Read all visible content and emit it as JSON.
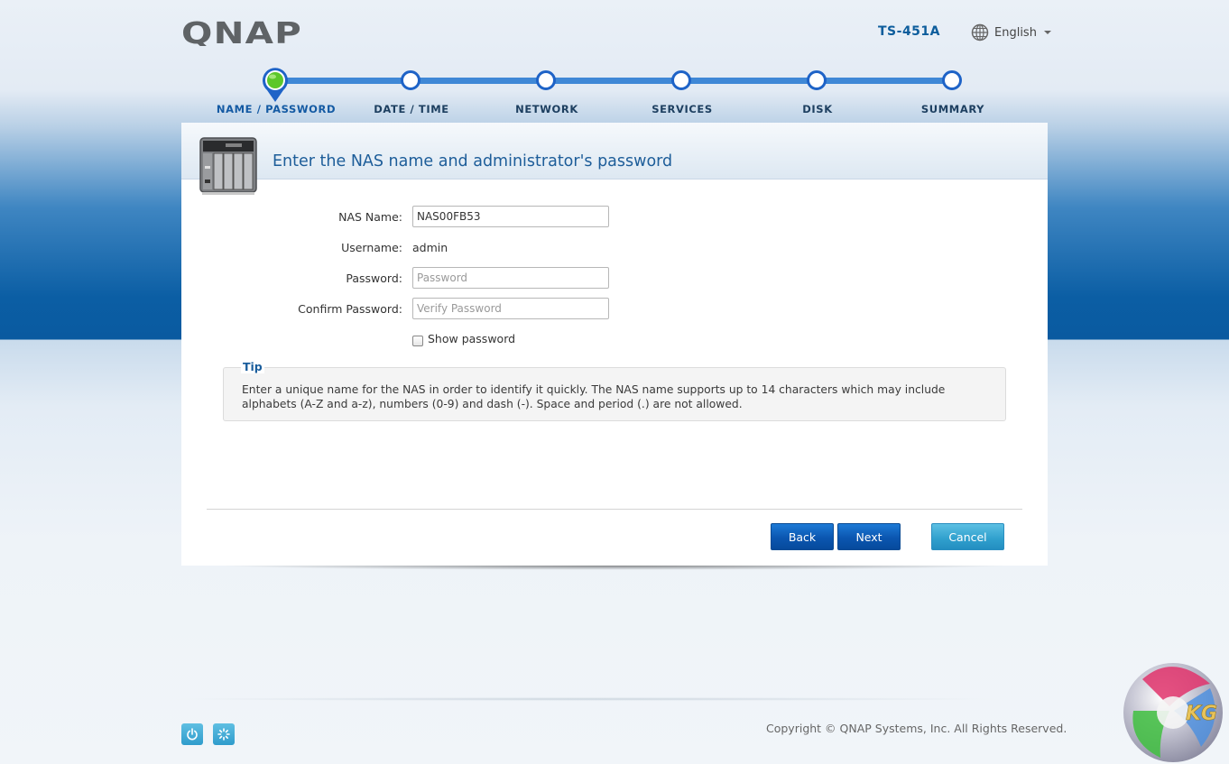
{
  "header": {
    "brand": "QNAP",
    "model": "TS-451A",
    "language": "English"
  },
  "steps": [
    {
      "label": "NAME / PASSWORD",
      "active": true
    },
    {
      "label": "DATE / TIME",
      "active": false
    },
    {
      "label": "NETWORK",
      "active": false
    },
    {
      "label": "SERVICES",
      "active": false
    },
    {
      "label": "DISK",
      "active": false
    },
    {
      "label": "SUMMARY",
      "active": false
    }
  ],
  "panel": {
    "title": "Enter the NAS name and administrator's password"
  },
  "form": {
    "nas_name_label": "NAS Name:",
    "nas_name_value": "NAS00FB53",
    "username_label": "Username:",
    "username_value": "admin",
    "password_label": "Password:",
    "password_placeholder": "Password",
    "confirm_label": "Confirm Password:",
    "confirm_placeholder": "Verify Password",
    "show_password_label": "Show password",
    "show_password_checked": false
  },
  "tip": {
    "title": "Tip",
    "text": "Enter a unique name for the NAS in order to identify it quickly. The NAS name supports up to 14 characters which may include alphabets (A-Z and a-z), numbers (0-9) and dash (-). Space and period (.) are not allowed."
  },
  "buttons": {
    "back": "Back",
    "next": "Next",
    "cancel": "Cancel"
  },
  "footer": {
    "power_icon": "power-icon",
    "settings_icon": "loading-icon",
    "copyright": "Copyright © QNAP Systems, Inc. All Rights Reserved."
  },
  "watermark": {
    "text": "KG"
  },
  "colors": {
    "accent_blue": "#0b56b0",
    "step_line": "#3f88d6",
    "active_step": "#5cc72a",
    "cancel_teal": "#2f9fcd",
    "title_blue": "#1d5d99"
  }
}
